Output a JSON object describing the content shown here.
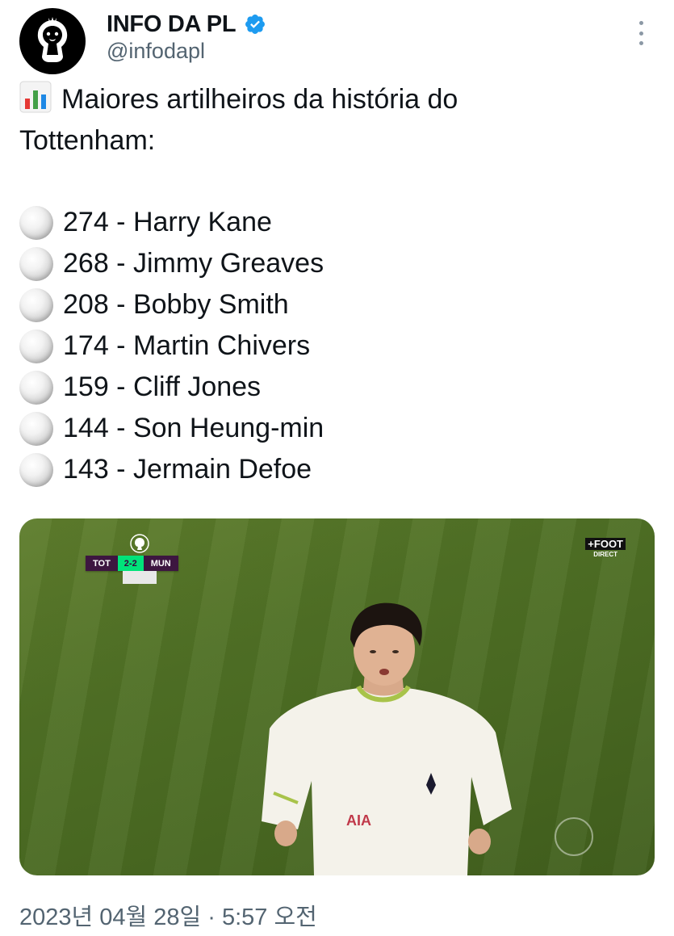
{
  "author": {
    "display_name": "INFO DA PL",
    "handle": "@infodapl",
    "avatar_icon": "premier-league-lion-logo",
    "verified_icon": "verified-badge-icon",
    "verified_color": "#1d9bf0"
  },
  "more_icon": "more-vertical-icon",
  "tweet": {
    "headline_icon": "bar-chart-emoji",
    "headline_line1": "Maiores artilheiros da história do",
    "headline_line2": "Tottenham:",
    "items": [
      {
        "icon": "football-emoji",
        "text": "274 - Harry Kane"
      },
      {
        "icon": "football-emoji",
        "text": "268 - Jimmy Greaves"
      },
      {
        "icon": "football-emoji",
        "text": "208 - Bobby Smith"
      },
      {
        "icon": "football-emoji",
        "text": "174 - Martin Chivers"
      },
      {
        "icon": "football-emoji",
        "text": "159 - Cliff Jones"
      },
      {
        "icon": "football-emoji",
        "text": "144 - Son Heung-min"
      },
      {
        "icon": "football-emoji",
        "text": "143 - Jermain Defoe"
      }
    ]
  },
  "media": {
    "scoreboard": {
      "home": "TOT",
      "score": "2-2",
      "away": "MUN"
    },
    "channel_logo_top": "+FOOT",
    "channel_logo_bottom": "DIRECT",
    "scoreboard_colors": {
      "team_bg": "#3d1640",
      "score_bg": "#00e37a"
    }
  },
  "timestamp": "2023년 04월 28일 · 5:57 오전"
}
